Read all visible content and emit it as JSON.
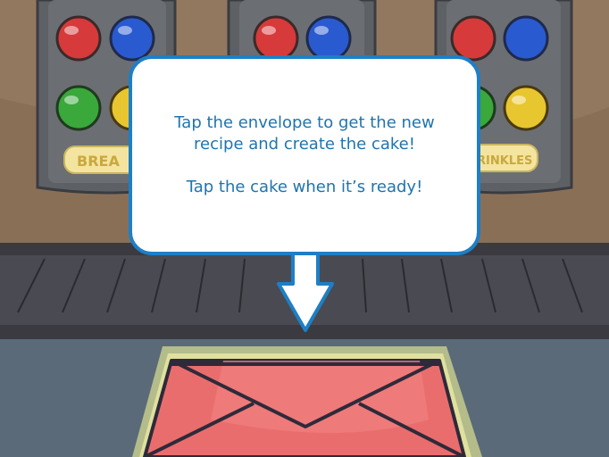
{
  "machines": [
    {
      "label": "BREA"
    },
    {
      "label": ""
    },
    {
      "label": "RINKLES"
    }
  ],
  "tooltip": {
    "line1": "Tap the envelope to get the new",
    "line2": "recipe and create the cake!",
    "line3": "Tap the cake when it’s ready!"
  },
  "colors": {
    "wall": "#8a6f57",
    "machine": "#5d6064",
    "belt": "#4a4a52",
    "counter": "#5a6a78",
    "envelope": "#ea6d6d",
    "tooltip_border": "#1e7fc6",
    "tooltip_text": "#1f74ad"
  },
  "icons": [
    "red-button-icon",
    "blue-button-icon",
    "green-button-icon",
    "yellow-button-icon",
    "down-arrow-icon",
    "envelope-icon"
  ]
}
